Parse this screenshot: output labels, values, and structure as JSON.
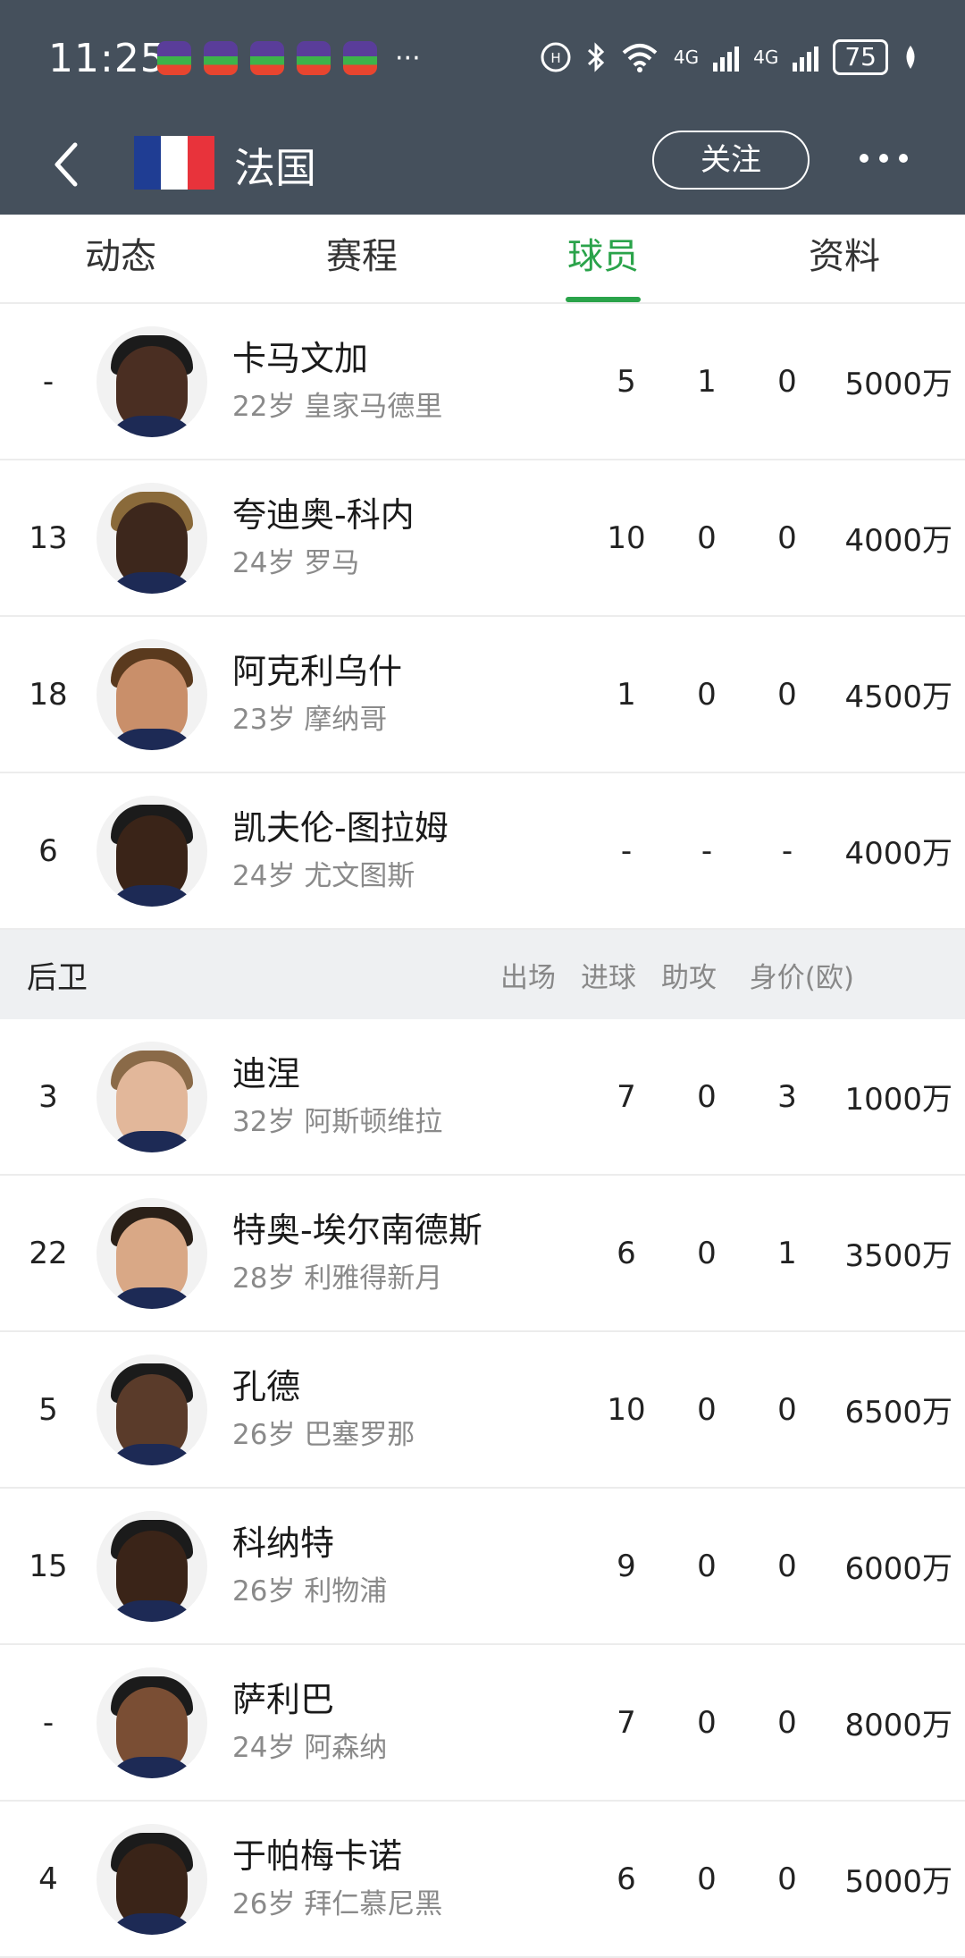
{
  "status_bar": {
    "time": "11:25",
    "more_dots": "···",
    "network_label": "4G",
    "battery": "75"
  },
  "nav": {
    "title": "法国",
    "follow_label": "关注",
    "flag_colors": [
      "#1f3d93",
      "#ffffff",
      "#e8333b"
    ]
  },
  "tabs": [
    {
      "label": "动态"
    },
    {
      "label": "赛程"
    },
    {
      "label": "球员",
      "active": true
    },
    {
      "label": "资料"
    }
  ],
  "top_players": [
    {
      "number": "-",
      "name": "卡马文加",
      "age": "22岁",
      "club": "皇家马德里",
      "apps": "5",
      "goals": "1",
      "assists": "0",
      "value": "5000万"
    },
    {
      "number": "13",
      "name": "夸迪奥-科内",
      "age": "24岁",
      "club": "罗马",
      "apps": "10",
      "goals": "0",
      "assists": "0",
      "value": "4000万"
    },
    {
      "number": "18",
      "name": "阿克利乌什",
      "age": "23岁",
      "club": "摩纳哥",
      "apps": "1",
      "goals": "0",
      "assists": "0",
      "value": "4500万"
    },
    {
      "number": "6",
      "name": "凯夫伦-图拉姆",
      "age": "24岁",
      "club": "尤文图斯",
      "apps": "-",
      "goals": "-",
      "assists": "-",
      "value": "4000万"
    }
  ],
  "defenders_section": {
    "title": "后卫",
    "col_apps": "出场",
    "col_goals": "进球",
    "col_assists": "助攻",
    "col_value": "身价(欧)"
  },
  "defenders": [
    {
      "number": "3",
      "name": "迪涅",
      "age": "32岁",
      "club": "阿斯顿维拉",
      "apps": "7",
      "goals": "0",
      "assists": "3",
      "value": "1000万"
    },
    {
      "number": "22",
      "name": "特奥-埃尔南德斯",
      "age": "28岁",
      "club": "利雅得新月",
      "apps": "6",
      "goals": "0",
      "assists": "1",
      "value": "3500万"
    },
    {
      "number": "5",
      "name": "孔德",
      "age": "26岁",
      "club": "巴塞罗那",
      "apps": "10",
      "goals": "0",
      "assists": "0",
      "value": "6500万"
    },
    {
      "number": "15",
      "name": "科纳特",
      "age": "26岁",
      "club": "利物浦",
      "apps": "9",
      "goals": "0",
      "assists": "0",
      "value": "6000万"
    },
    {
      "number": "-",
      "name": "萨利巴",
      "age": "24岁",
      "club": "阿森纳",
      "apps": "7",
      "goals": "0",
      "assists": "0",
      "value": "8000万"
    },
    {
      "number": "4",
      "name": "于帕梅卡诺",
      "age": "26岁",
      "club": "拜仁慕尼黑",
      "apps": "6",
      "goals": "0",
      "assists": "0",
      "value": "5000万"
    }
  ],
  "colors": {
    "header_bg": "#45505c",
    "accent_green": "#2aa34a",
    "section_bg": "#eef0f2"
  }
}
